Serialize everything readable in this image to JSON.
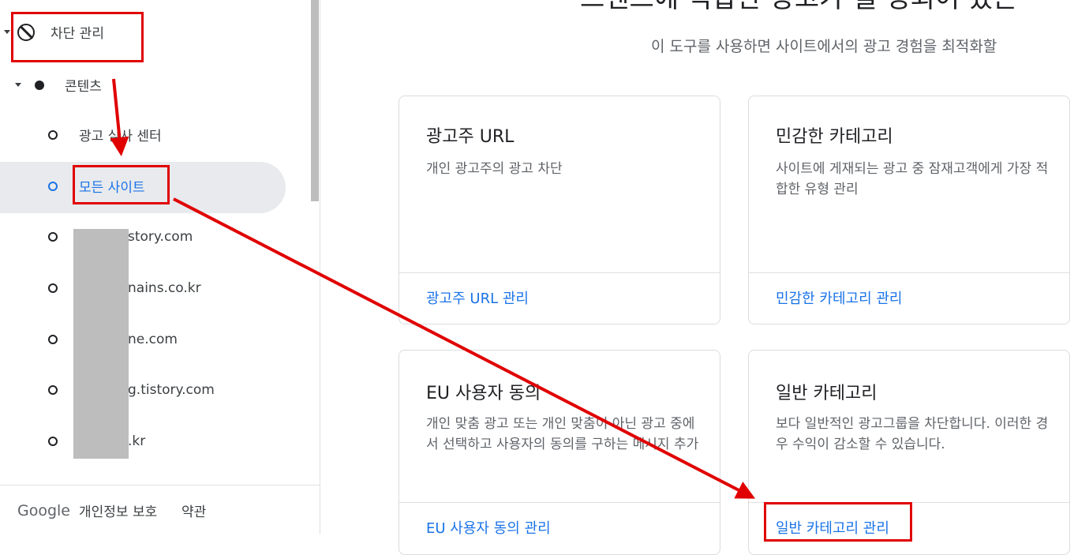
{
  "sidebar": {
    "block_mgmt": "차단 관리",
    "content": "콘텐츠",
    "ad_review": "광고 심사 센터",
    "all_sites": "모든 사이트",
    "sites": [
      "story.com",
      "nains.co.kr",
      "ne.com",
      "g.tistory.com",
      ".kr"
    ],
    "footer": {
      "logo": "Google",
      "privacy": "개인정보 보호",
      "terms": "약관"
    }
  },
  "main": {
    "title": "스텐스에 적합한 광고가 될 정되어 있는",
    "subtitle": "이 도구를 사용하면 사이트에서의 광고 경험을 최적화할",
    "cards": [
      {
        "title": "광고주 URL",
        "desc": "개인 광고주의 광고 차단",
        "link": "광고주 URL 관리"
      },
      {
        "title": "민감한 카테고리",
        "desc": "사이트에 게재되는 광고 중 잠재고객에게 가장 적합한 유형 관리",
        "link": "민감한 카테고리 관리"
      },
      {
        "title": "EU 사용자 동의",
        "desc": "개인 맞춤 광고 또는 개인 맞춤이 아닌 광고 중에서 선택하고 사용자의 동의를 구하는 메시지 추가",
        "link": "EU 사용자 동의 관리"
      },
      {
        "title": "일반 카테고리",
        "desc": "보다 일반적인 광고그룹을 차단합니다. 이러한 경우 수익이 감소할 수 있습니다.",
        "link": "일반 카테고리 관리"
      }
    ]
  },
  "colors": {
    "accent": "#1a73e8",
    "annotation": "#e00000"
  }
}
